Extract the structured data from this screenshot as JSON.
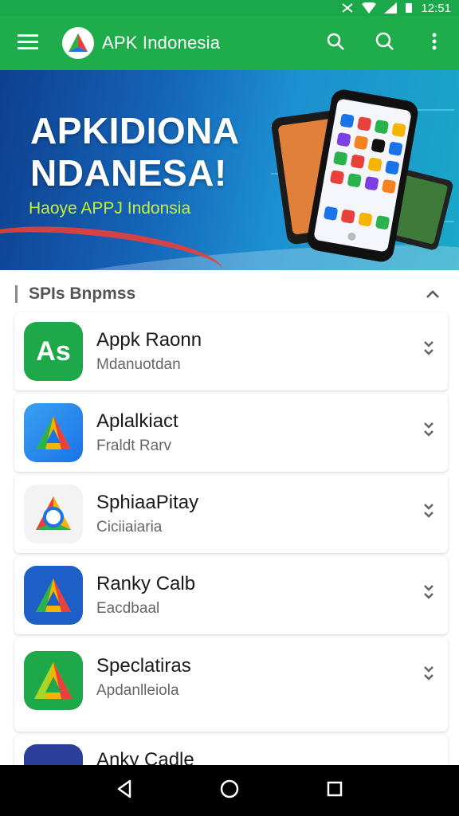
{
  "status_bar": {
    "time": "12:51"
  },
  "app_bar": {
    "title": "APK Indonesia",
    "brand_color": "#1fad4c"
  },
  "banner": {
    "title": "APKIDIONA\nNDANESA!",
    "subtitle": "Haoye APPJ Indonsia"
  },
  "section": {
    "title": "SPIs Bnpmss"
  },
  "apps": [
    {
      "name": "Appk Raonn",
      "sub": "Mdanuotdan"
    },
    {
      "name": "Aplalkiact",
      "sub": "Fraldt Rarv"
    },
    {
      "name": "SphiaaPitay",
      "sub": "Ciciiaiaria"
    },
    {
      "name": "Ranky Calb",
      "sub": "Eacdbaal"
    },
    {
      "name": "Speclatiras",
      "sub": "Apdanlleiola"
    },
    {
      "name": "Anky Cadle",
      "sub": ""
    }
  ],
  "icons": [
    "menu-icon",
    "search-icon",
    "more-vert-icon",
    "download-icon",
    "chevron-up-icon",
    "back-icon",
    "home-icon",
    "recents-icon"
  ]
}
